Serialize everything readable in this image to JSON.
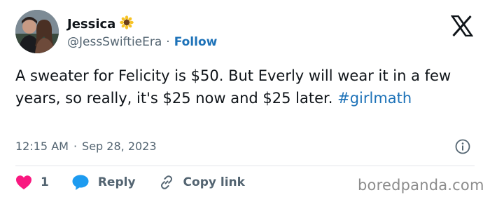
{
  "user": {
    "display_name": "Jessica",
    "name_emoji": "sunflower-icon",
    "handle": "@JessSwiftieEra",
    "separator": "·",
    "follow_label": "Follow"
  },
  "tweet": {
    "text": "A sweater for Felicity is $50. But Everly will wear it in a few years, so really, it's $25 now and $25 later. ",
    "hashtag": "#girlmath",
    "time": "12:15 AM",
    "meta_separator": "·",
    "date": "Sep 28, 2023"
  },
  "actions": {
    "like_count": "1",
    "reply_label": "Reply",
    "copy_label": "Copy link"
  },
  "watermark": "boredpanda.com",
  "colors": {
    "link": "#1d72b8",
    "like": "#f91880",
    "reply_icon": "#1d9bf0",
    "secondary_text": "#536471"
  }
}
